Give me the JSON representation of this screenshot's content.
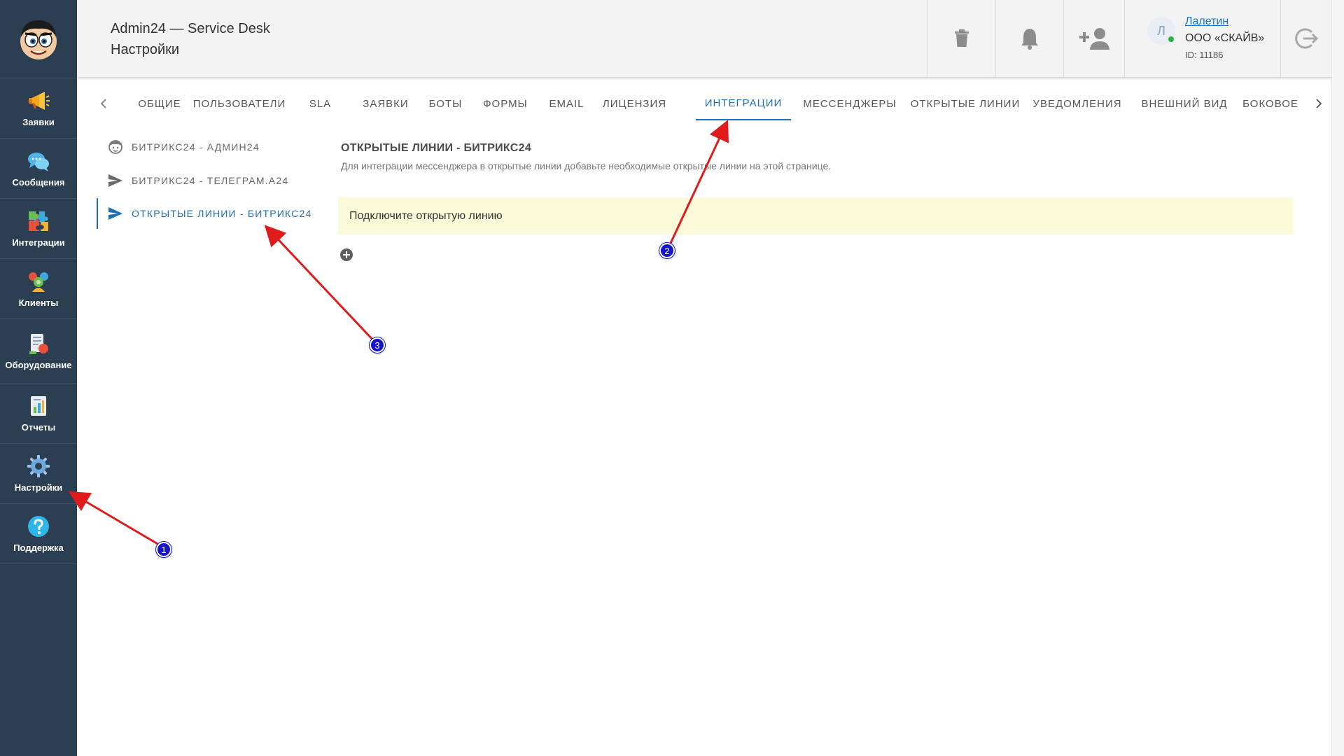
{
  "sidebar": {
    "items": [
      {
        "label": "Заявки",
        "icon": "megaphone-icon"
      },
      {
        "label": "Сообщения",
        "icon": "chat-bubbles-icon"
      },
      {
        "label": "Интеграции",
        "icon": "puzzle-icon"
      },
      {
        "label": "Клиенты",
        "icon": "clients-icon"
      },
      {
        "label": "Оборудование",
        "icon": "equipment-icon"
      },
      {
        "label": "Отчеты",
        "icon": "report-icon"
      },
      {
        "label": "Настройки",
        "icon": "gear-icon"
      },
      {
        "label": "Поддержка",
        "icon": "help-icon"
      }
    ]
  },
  "header": {
    "app_title": "Admin24 — Service Desk",
    "page_title": "Настройки",
    "user": {
      "initial": "Л",
      "name": "Лалетин",
      "company": "ООО «СКАЙВ»",
      "id": "ID: 11186"
    }
  },
  "tabs": [
    "ОБЩИЕ",
    "ПОЛЬЗОВАТЕЛИ",
    "SLA",
    "ЗАЯВКИ",
    "БОТЫ",
    "ФОРМЫ",
    "EMAIL",
    "ЛИЦЕНЗИЯ",
    "ИНТЕГРАЦИИ",
    "МЕССЕНДЖЕРЫ",
    "ОТКРЫТЫЕ ЛИНИИ",
    "УВЕДОМЛЕНИЯ",
    "ВНЕШНИЙ ВИД",
    "БОКОВОЕ"
  ],
  "active_tab": "ИНТЕГРАЦИИ",
  "subnav": [
    {
      "label": "БИТРИКС24 - АДМИН24",
      "icon": "face-icon"
    },
    {
      "label": "БИТРИКС24 - ТЕЛЕГРАМ.А24",
      "icon": "send-icon"
    },
    {
      "label": "ОТКРЫТЫЕ ЛИНИИ - БИТРИКС24",
      "icon": "send-icon"
    }
  ],
  "content": {
    "title": "ОТКРЫТЫЕ ЛИНИИ - БИТРИКС24",
    "description": "Для интеграции мессенджера в открытые линии добавьте необходимые открытые линии на этой странице.",
    "alert": "Подключите открытую линию"
  },
  "annotations": [
    "1",
    "2",
    "3"
  ],
  "colors": {
    "sidebar": "#2c3e52",
    "accent": "#1f6fb8",
    "alert_bg": "#fcfbd9",
    "arrow": "#e01b1b",
    "badge": "#1414c8"
  }
}
